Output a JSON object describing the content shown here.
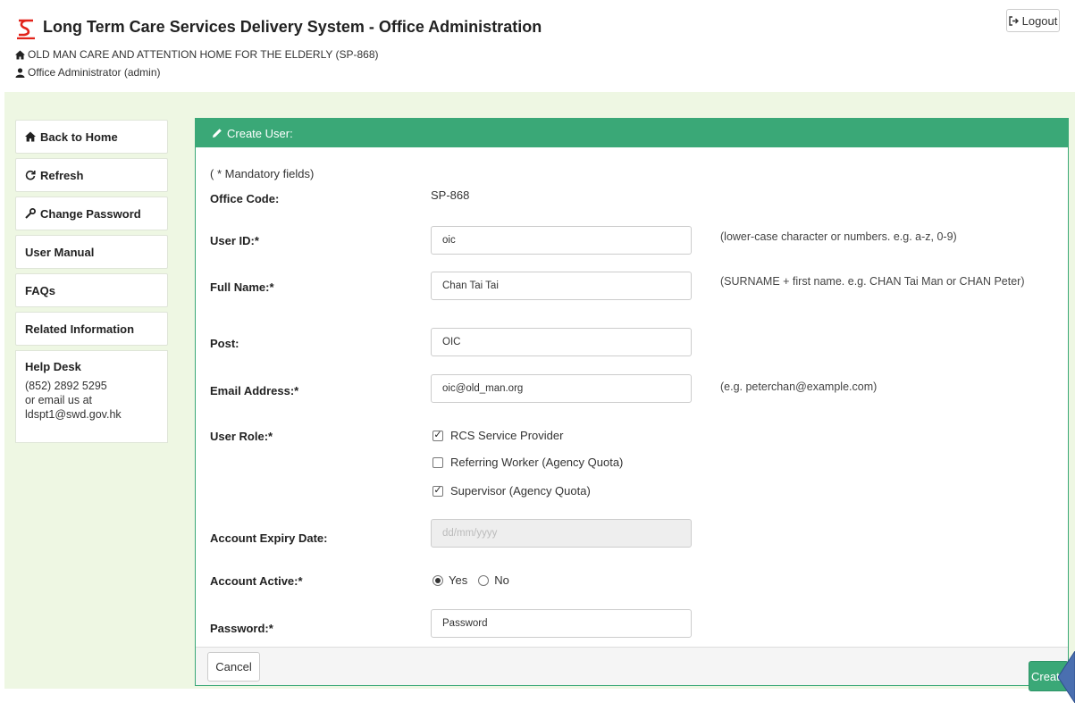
{
  "header": {
    "app_title": "Long Term Care Services Delivery System - Office Administration",
    "logout_label": "Logout",
    "organization": "OLD MAN CARE AND ATTENTION HOME FOR THE ELDERLY (SP-868)",
    "user": "Office Administrator (admin)"
  },
  "sidebar": {
    "items": [
      {
        "label": "Back to Home",
        "icon": "home-icon"
      },
      {
        "label": "Refresh",
        "icon": "refresh-icon"
      },
      {
        "label": "Change Password",
        "icon": "wrench-icon"
      },
      {
        "label": "User Manual"
      },
      {
        "label": "FAQs"
      },
      {
        "label": "Related Information"
      }
    ],
    "helpdesk": {
      "title": "Help Desk",
      "phone": "(852) 2892 5295",
      "email_prefix": "or email us at",
      "email": "ldspt1@swd.gov.hk"
    }
  },
  "form": {
    "heading": "Create User:",
    "mandatory_note": "( * Mandatory fields)",
    "office_code": {
      "label": "Office Code:",
      "value": "SP-868"
    },
    "user_id": {
      "label": "User ID:*",
      "value": "oic",
      "hint": "(lower-case character or numbers. e.g. a-z, 0-9)"
    },
    "full_name": {
      "label": "Full Name:*",
      "value": "Chan Tai Tai",
      "hint": "(SURNAME + first name. e.g. CHAN Tai Man or CHAN Peter)"
    },
    "post": {
      "label": "Post:",
      "value": "OIC"
    },
    "email": {
      "label": "Email Address:*",
      "value": "oic@old_man.org",
      "hint": "(e.g. peterchan@example.com)"
    },
    "user_role": {
      "label": "User Role:*",
      "options": [
        {
          "label": "RCS Service Provider",
          "checked": true
        },
        {
          "label": "Referring Worker (Agency Quota)",
          "checked": false
        },
        {
          "label": "Supervisor (Agency Quota)",
          "checked": true
        }
      ]
    },
    "expiry": {
      "label": "Account Expiry Date:",
      "placeholder": "dd/mm/yyyy"
    },
    "active": {
      "label": "Account Active:*",
      "yes": "Yes",
      "no": "No",
      "selected": "Yes"
    },
    "password": {
      "label": "Password:*",
      "value": "Password"
    },
    "cancel_label": "Cancel",
    "create_label": "Create"
  },
  "colors": {
    "accent": "#3aa877",
    "content_bg": "#eef7e3",
    "logo": "#e2231a"
  }
}
